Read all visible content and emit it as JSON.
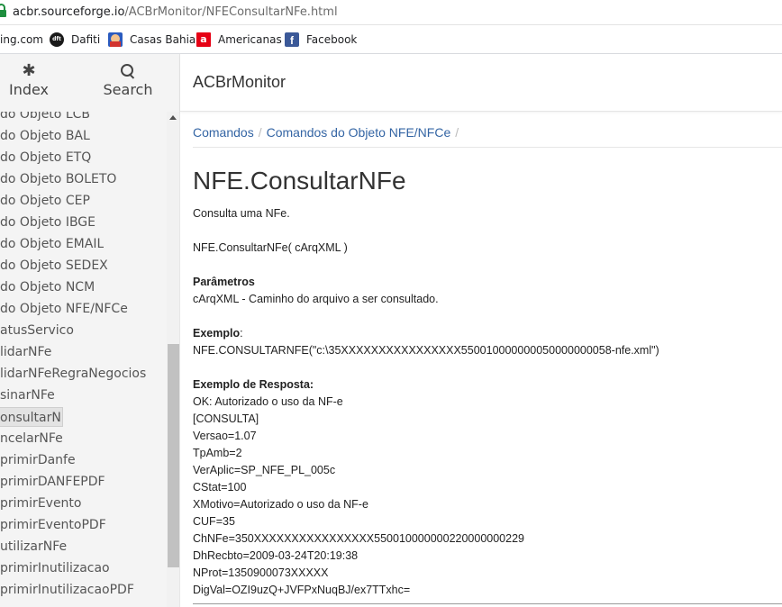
{
  "browser": {
    "url_domain": "acbr.sourceforge.io",
    "url_path": "/ACBrMonitor/NFEConsultarNFe.html"
  },
  "bookmarks": [
    {
      "label": "ing.com"
    },
    {
      "label": "Dafiti",
      "icon": "dafiti-icon",
      "icon_text": "dft"
    },
    {
      "label": "Casas Bahia",
      "icon": "casas-bahia-icon"
    },
    {
      "label": "Americanas",
      "icon": "americanas-icon",
      "icon_text": "a"
    },
    {
      "label": "Facebook",
      "icon": "facebook-icon",
      "icon_text": "f"
    }
  ],
  "sidebar": {
    "nav": {
      "index_label": "Index",
      "search_label": "Search"
    },
    "items": [
      "do Objeto LCB",
      "do Objeto BAL",
      "do Objeto ETQ",
      "do Objeto BOLETO",
      "do Objeto CEP",
      "do Objeto IBGE",
      "do Objeto EMAIL",
      "do Objeto SEDEX",
      "do Objeto NCM",
      "do Objeto NFE/NFCe",
      "atusServico",
      "lidarNFe",
      "lidarNFeRegraNegocios",
      "sinarNFe",
      "onsultarNFe",
      "ncelarNFe",
      "primirDanfe",
      "primirDANFEPDF",
      "primirEvento",
      "primirEventoPDF",
      "utilizarNFe",
      "primirInutilizacao",
      "primirInutilizacaoPDF"
    ],
    "current_index": 14
  },
  "header": {
    "title": "ACBrMonitor"
  },
  "breadcrumb": {
    "items": [
      "Comandos",
      "Comandos do Objeto NFE/NFCe"
    ],
    "separator": "/"
  },
  "page": {
    "title": "NFE.ConsultarNFe",
    "description": "Consulta uma NFe.",
    "signature": "NFE.ConsultarNFe( cArqXML )",
    "params_heading": "Parâmetros",
    "param_line": "cArqXML - Caminho do arquivo a ser consultado.",
    "example_heading": "Exemplo",
    "example_colon": ":",
    "example_line": "NFE.CONSULTARNFE(\"c:\\35XXXXXXXXXXXXXXXX550010000000050000000058-nfe.xml\")",
    "response_heading": "Exemplo de Resposta:",
    "response_lines": [
      "OK: Autorizado o uso da NF-e",
      "[CONSULTA]",
      "Versao=1.07",
      "TpAmb=2",
      "VerAplic=SP_NFE_PL_005c",
      "CStat=100",
      "XMotivo=Autorizado o uso da NF-e",
      "CUF=35",
      "ChNFe=350XXXXXXXXXXXXXXXX550010000000220000000229",
      "DhRecbto=2009-03-24T20:19:38",
      "NProt=1350900073XXXXX",
      "DigVal=OZI9uzQ+JVFPxNuqBJ/ex7TTxhc="
    ]
  }
}
